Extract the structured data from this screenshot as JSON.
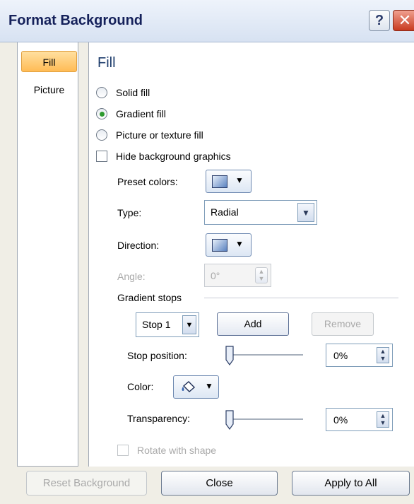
{
  "window": {
    "title": "Format Background",
    "help": "?",
    "close": "✕"
  },
  "nav": {
    "items": [
      {
        "label": "Fill"
      },
      {
        "label": "Picture"
      }
    ]
  },
  "fill": {
    "header": "Fill",
    "options": {
      "solid": "Solid fill",
      "gradient": "Gradient fill",
      "picture": "Picture or texture fill",
      "hide_bg": "Hide background graphics"
    },
    "preset_colors_label": "Preset colors:",
    "type_label": "Type:",
    "type_value": "Radial",
    "direction_label": "Direction:",
    "angle_label": "Angle:",
    "angle_value": "0°",
    "gradient_stops_label": "Gradient stops",
    "stop_value": "Stop 1",
    "add": "Add",
    "remove": "Remove",
    "stop_position_label": "Stop position:",
    "stop_position_value": "0%",
    "color_label": "Color:",
    "transparency_label": "Transparency:",
    "transparency_value": "0%",
    "rotate_with_shape": "Rotate with shape"
  },
  "footer": {
    "reset": "Reset Background",
    "close": "Close",
    "apply_all": "Apply to All"
  },
  "colors": {
    "title_text": "#15215a",
    "fill_header": "#1f3e6d",
    "radio_selected": "#2e9a2e",
    "nav_selected": "#ffbb55"
  }
}
